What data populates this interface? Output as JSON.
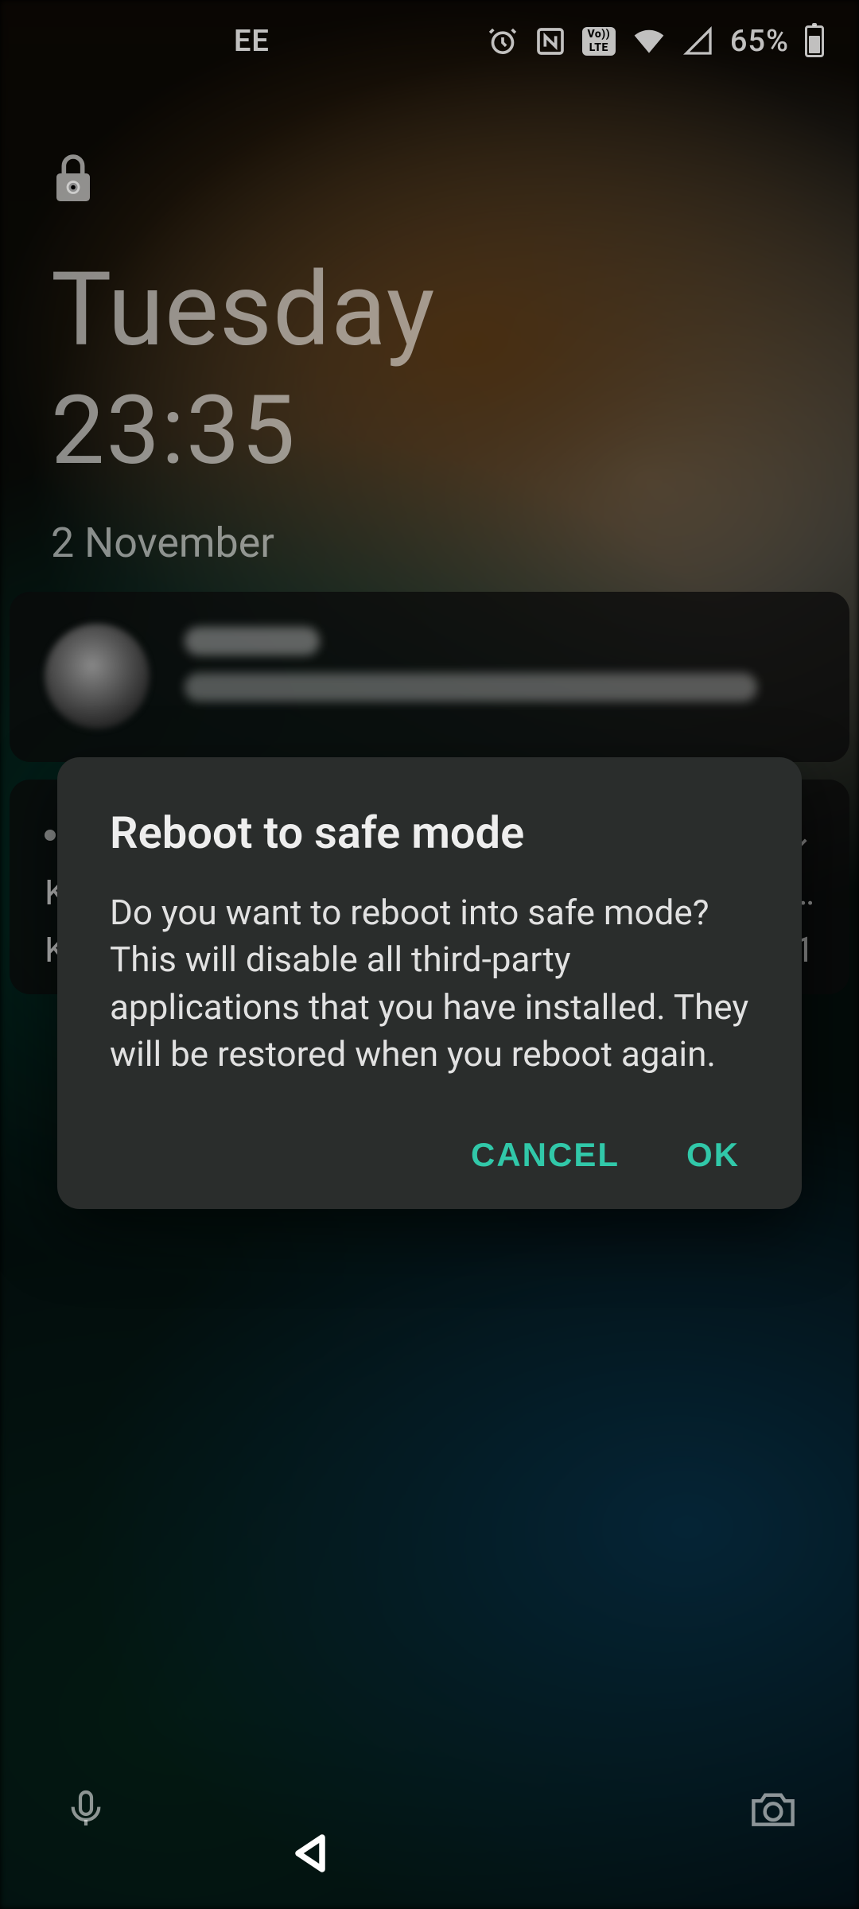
{
  "statusbar": {
    "carrier": "EE",
    "alarm_icon": "alarm-icon",
    "nfc_icon": "nfc-icon",
    "volte_top": "Vo))",
    "volte_bottom": "LTE",
    "wifi_icon": "wifi-icon",
    "signal_icon": "cellular-signal-icon",
    "battery_pct": "65%",
    "battery_icon": "battery-icon"
  },
  "lockscreen": {
    "lock_icon": "lock-icon",
    "day": "Tuesday",
    "time": "23:35",
    "date": "2 November"
  },
  "notifications": {
    "card2": {
      "letter1": "K",
      "letter2": "K",
      "trailing": "1"
    }
  },
  "dialog": {
    "title": "Reboot to safe mode",
    "body": "Do you want to reboot into safe mode? This will disable all third-party applications that you have installed. They will be restored when you reboot again.",
    "cancel": "CANCEL",
    "ok": "OK",
    "accent": "#31c8a9"
  },
  "bottombar": {
    "mic_icon": "microphone-icon",
    "camera_icon": "camera-icon",
    "back_icon": "back-nav-icon"
  }
}
